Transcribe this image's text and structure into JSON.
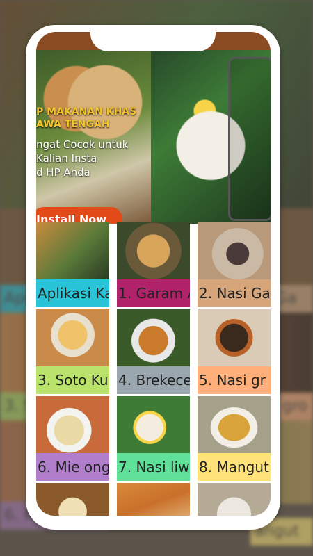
{
  "banner": {
    "title_line1": "P MAKANAN KHAS",
    "title_line2": "AWA TENGAH",
    "sub_line1": "ngat Cocok untuk",
    "sub_line2": "Kalian Insta",
    "sub_line3": "d HP Anda",
    "install_label": "Install Now"
  },
  "grid": {
    "items": [
      {
        "label": "Aplikasi Ka",
        "color": "#29c4d8"
      },
      {
        "label": "1. Garam A",
        "color": "#b0236a"
      },
      {
        "label": "2. Nasi Ga",
        "color": "#d7a57a"
      },
      {
        "label": "3. Soto Ku",
        "color": "#b9e36b"
      },
      {
        "label": "4. Brekece",
        "color": "#9aa7ae"
      },
      {
        "label": "5. Nasi gr",
        "color": "#ffb07a"
      },
      {
        "label": "6. Mie ong",
        "color": "#b07ecb"
      },
      {
        "label": "7. Nasi liw",
        "color": "#5fe19a"
      },
      {
        "label": "8. Mangut",
        "color": "#ffe37a"
      },
      {
        "label": "",
        "color": "#ffffff"
      },
      {
        "label": "",
        "color": "#ffffff"
      },
      {
        "label": "",
        "color": "#ffffff"
      }
    ]
  },
  "backdrop": {
    "labels": [
      "Apl",
      "Ga",
      "3. S",
      "gro",
      "6. M",
      "angut"
    ]
  }
}
